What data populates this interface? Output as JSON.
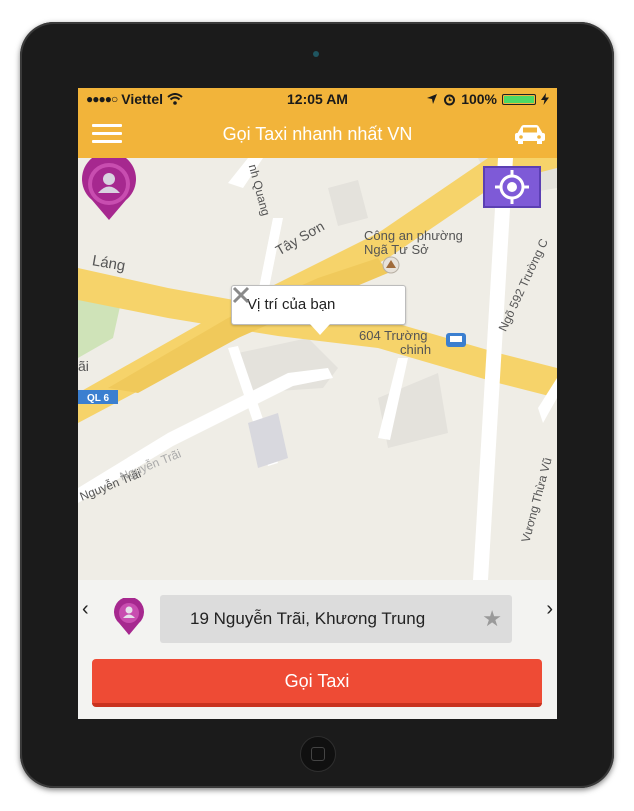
{
  "status_bar": {
    "signal_dots": "●●●●○",
    "carrier": "Viettel",
    "wifi_icon": "wifi-icon",
    "time": "12:05 AM",
    "location_icon": "location-arrow-icon",
    "alarm_icon": "alarm-clock-icon",
    "battery_percent": "100%",
    "battery_level": 1.0,
    "charging_icon": "charging-bolt-icon"
  },
  "header": {
    "menu_icon": "hamburger-menu-icon",
    "title": "Gọi Taxi nhanh nhất VN",
    "car_icon": "car-icon"
  },
  "map": {
    "locate_button_icon": "crosshair-locate-icon",
    "callout_text": "Vị trí của bạn",
    "callout_close_icon": "close-icon",
    "pin_icon": "user-location-pin-icon",
    "labels": {
      "lang": "Láng",
      "tay_son": "Tây Sơn",
      "thinh_quang": "nh Quang",
      "cong_an_1": "Công an phường",
      "cong_an_2": "Ngã Tư Sở",
      "truong_chinh_1": "604 Trường",
      "truong_chinh_2": "chinh",
      "ngo_592": "Ngõ 592 Trường C",
      "ql6": "QL 6",
      "nguyen_trai_1": "Nguyễn Trãi",
      "nguyen_trai_2": "Nguyễn Trãi",
      "vuong_thua_vu": "Vương Thừa Vũ",
      "edge_ai": "ãi"
    }
  },
  "address_bar": {
    "prev_icon": "chevron-left-icon",
    "next_icon": "chevron-right-icon",
    "pin_icon": "user-location-pin-icon",
    "address": "19 Nguyễn Trãi, Khương Trung",
    "favorite_icon": "star-icon",
    "prev_glyph": "‹",
    "next_glyph": "›",
    "star_glyph": "★"
  },
  "actions": {
    "call_taxi_label": "Gọi Taxi"
  },
  "colors": {
    "header": "#f2b43a",
    "call_button": "#ee4b35",
    "pin": "#a6288f",
    "locate_button": "#7e5ad7",
    "road_major": "#f6d36a"
  }
}
